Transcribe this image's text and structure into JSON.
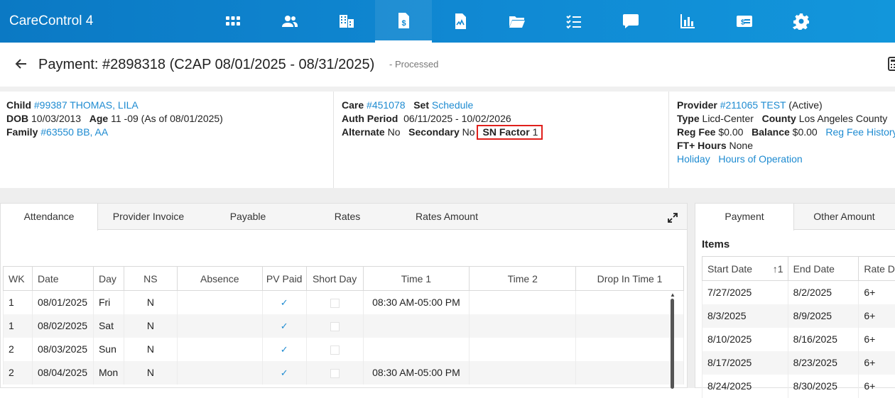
{
  "app": {
    "title": "CareControl 4"
  },
  "nav": [
    "apps-icon",
    "users-icon",
    "buildings-icon",
    "payment-doc-icon",
    "document-chart-icon",
    "folder-icon",
    "checklist-icon",
    "chat-icon",
    "bar-chart-icon",
    "id-card-icon",
    "gear-icon"
  ],
  "page": {
    "title": "Payment: #2898318 (C2AP 08/01/2025 - 08/31/2025)",
    "status": "- Processed"
  },
  "child": {
    "child_label": "Child",
    "child_value": "#99387 THOMAS, LILA",
    "dob_label": "DOB",
    "dob_value": "10/03/2013",
    "age_label": "Age",
    "age_value": "11 -09 (As of 08/01/2025)",
    "family_label": "Family",
    "family_value": "#63550 BB, AA"
  },
  "care": {
    "care_label": "Care",
    "care_value": "#451078",
    "set_label": "Set",
    "set_value": "Schedule",
    "auth_label": "Auth Period",
    "auth_value": "06/11/2025 - 10/02/2026",
    "alternate_label": "Alternate",
    "alternate_value": "No",
    "secondary_label": "Secondary",
    "secondary_value": "No",
    "sn_label": "SN Factor",
    "sn_value": "1"
  },
  "provider": {
    "provider_label": "Provider",
    "provider_value": "#211065 TEST",
    "provider_status": "(Active)",
    "type_label": "Type",
    "type_value": "Licd-Center",
    "county_label": "County",
    "county_value": "Los Angeles County",
    "regfee_label": "Reg Fee",
    "regfee_value": "$0.00",
    "balance_label": "Balance",
    "balance_value": "$0.00",
    "regfee_history": "Reg Fee History",
    "ft_label": "FT+ Hours",
    "ft_value": "None",
    "holiday": "Holiday",
    "hours": "Hours of Operation"
  },
  "left_tabs": [
    "Attendance",
    "Provider Invoice",
    "Payable",
    "Rates",
    "Rates Amount"
  ],
  "attendance": {
    "columns": [
      "WK",
      "Date",
      "Day",
      "NS",
      "Absence",
      "PV Paid",
      "Short Day",
      "Time 1",
      "Time 2",
      "Drop In Time 1"
    ],
    "rows": [
      {
        "wk": "1",
        "date": "08/01/2025",
        "day": "Fri",
        "ns": "N",
        "absence": "",
        "pv_paid": true,
        "short_day": false,
        "time1": "08:30 AM-05:00 PM",
        "time2": "",
        "drop1": ""
      },
      {
        "wk": "1",
        "date": "08/02/2025",
        "day": "Sat",
        "ns": "N",
        "absence": "",
        "pv_paid": true,
        "short_day": false,
        "time1": "",
        "time2": "",
        "drop1": ""
      },
      {
        "wk": "2",
        "date": "08/03/2025",
        "day": "Sun",
        "ns": "N",
        "absence": "",
        "pv_paid": true,
        "short_day": false,
        "time1": "",
        "time2": "",
        "drop1": ""
      },
      {
        "wk": "2",
        "date": "08/04/2025",
        "day": "Mon",
        "ns": "N",
        "absence": "",
        "pv_paid": true,
        "short_day": false,
        "time1": "08:30 AM-05:00 PM",
        "time2": "",
        "drop1": ""
      }
    ]
  },
  "right_tabs": [
    "Payment",
    "Other Amount"
  ],
  "items": {
    "title": "Items",
    "columns": [
      "Start Date",
      "End Date",
      "Rate D"
    ],
    "sort_indicator": "↑1",
    "rows": [
      {
        "start": "7/27/2025",
        "end": "8/2/2025",
        "rate": "6+"
      },
      {
        "start": "8/3/2025",
        "end": "8/9/2025",
        "rate": "6+"
      },
      {
        "start": "8/10/2025",
        "end": "8/16/2025",
        "rate": "6+"
      },
      {
        "start": "8/17/2025",
        "end": "8/23/2025",
        "rate": "6+"
      },
      {
        "start": "8/24/2025",
        "end": "8/30/2025",
        "rate": "6+"
      }
    ]
  },
  "colors": {
    "brand": "#0b79c4",
    "link": "#1e8bd1",
    "highlight": "#e0201c"
  }
}
